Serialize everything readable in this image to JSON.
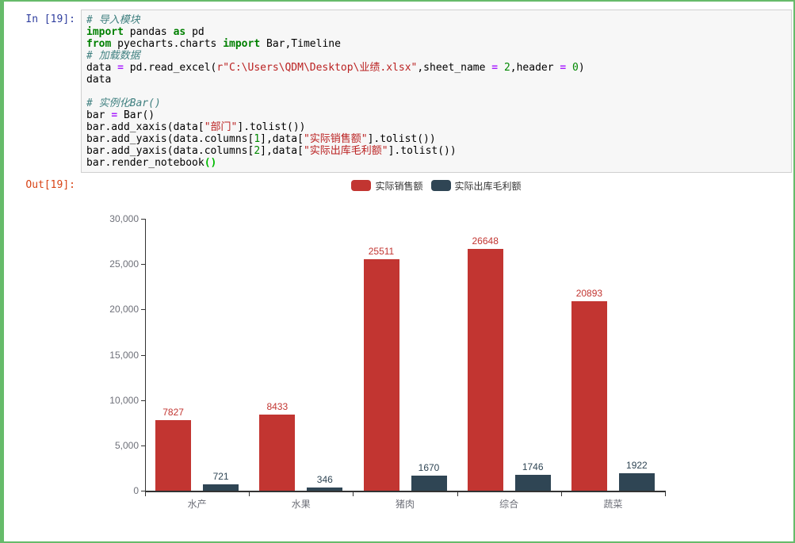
{
  "cell": {
    "in_prompt": "In [19]:",
    "out_prompt": "Out[19]:"
  },
  "code": {
    "lines": [
      [
        {
          "t": "# 导入模块",
          "s": "com"
        }
      ],
      [
        {
          "t": "import",
          "s": "kw"
        },
        {
          "t": " pandas ",
          "s": "plain"
        },
        {
          "t": "as",
          "s": "kw"
        },
        {
          "t": " pd",
          "s": "plain"
        }
      ],
      [
        {
          "t": "from",
          "s": "kw"
        },
        {
          "t": " pyecharts.charts ",
          "s": "plain"
        },
        {
          "t": "import",
          "s": "kw"
        },
        {
          "t": " Bar,Timeline",
          "s": "plain"
        }
      ],
      [
        {
          "t": "# 加载数据",
          "s": "com"
        }
      ],
      [
        {
          "t": "data ",
          "s": "plain"
        },
        {
          "t": "=",
          "s": "op"
        },
        {
          "t": " pd.read_excel(",
          "s": "plain"
        },
        {
          "t": "r\"C:\\Users\\QDM\\Desktop\\业绩.xlsx\"",
          "s": "str"
        },
        {
          "t": ",sheet_name ",
          "s": "plain"
        },
        {
          "t": "=",
          "s": "op"
        },
        {
          "t": " ",
          "s": "plain"
        },
        {
          "t": "2",
          "s": "num"
        },
        {
          "t": ",header ",
          "s": "plain"
        },
        {
          "t": "=",
          "s": "op"
        },
        {
          "t": " ",
          "s": "plain"
        },
        {
          "t": "0",
          "s": "num"
        },
        {
          "t": ")",
          "s": "plain"
        }
      ],
      [
        {
          "t": "data",
          "s": "plain"
        }
      ],
      [],
      [
        {
          "t": "# 实例化Bar()",
          "s": "com"
        }
      ],
      [
        {
          "t": "bar ",
          "s": "plain"
        },
        {
          "t": "=",
          "s": "op"
        },
        {
          "t": " Bar()",
          "s": "plain"
        }
      ],
      [
        {
          "t": "bar.add_xaxis(data[",
          "s": "plain"
        },
        {
          "t": "\"部门\"",
          "s": "str"
        },
        {
          "t": "].tolist())",
          "s": "plain"
        }
      ],
      [
        {
          "t": "bar.add_yaxis(data.columns[",
          "s": "plain"
        },
        {
          "t": "1",
          "s": "num"
        },
        {
          "t": "],data[",
          "s": "plain"
        },
        {
          "t": "\"实际销售额\"",
          "s": "str"
        },
        {
          "t": "].tolist())",
          "s": "plain"
        }
      ],
      [
        {
          "t": "bar.add_yaxis(data.columns[",
          "s": "plain"
        },
        {
          "t": "2",
          "s": "num"
        },
        {
          "t": "],data[",
          "s": "plain"
        },
        {
          "t": "\"实际出库毛利额\"",
          "s": "str"
        },
        {
          "t": "].tolist())",
          "s": "plain"
        }
      ],
      [
        {
          "t": "bar.render_notebook",
          "s": "plain"
        },
        {
          "t": "()",
          "s": "brk"
        }
      ]
    ]
  },
  "chart_data": {
    "type": "bar",
    "title": "",
    "xlabel": "",
    "ylabel": "",
    "categories": [
      "水产",
      "水果",
      "猪肉",
      "综合",
      "蔬菜"
    ],
    "series": [
      {
        "name": "实际销售额",
        "color": "#c23531",
        "values": [
          7827,
          8433,
          25511,
          26648,
          20893
        ]
      },
      {
        "name": "实际出库毛利额",
        "color": "#2f4554",
        "values": [
          721,
          346,
          1670,
          1746,
          1922
        ]
      }
    ],
    "ylim": [
      0,
      30000
    ],
    "y_ticks": [
      0,
      5000,
      10000,
      15000,
      20000,
      25000,
      30000
    ],
    "y_tick_labels": [
      "0",
      "5,000",
      "10,000",
      "15,000",
      "20,000",
      "25,000",
      "30,000"
    ],
    "grid": false,
    "legend_position": "top",
    "value_labels": true
  },
  "colors": {
    "cell_border": "#66bb6a",
    "in_prompt": "#303F9F",
    "out_prompt": "#D84315",
    "axis": "#333333",
    "axis_label": "#6E7079",
    "legend_text": "#333333"
  }
}
